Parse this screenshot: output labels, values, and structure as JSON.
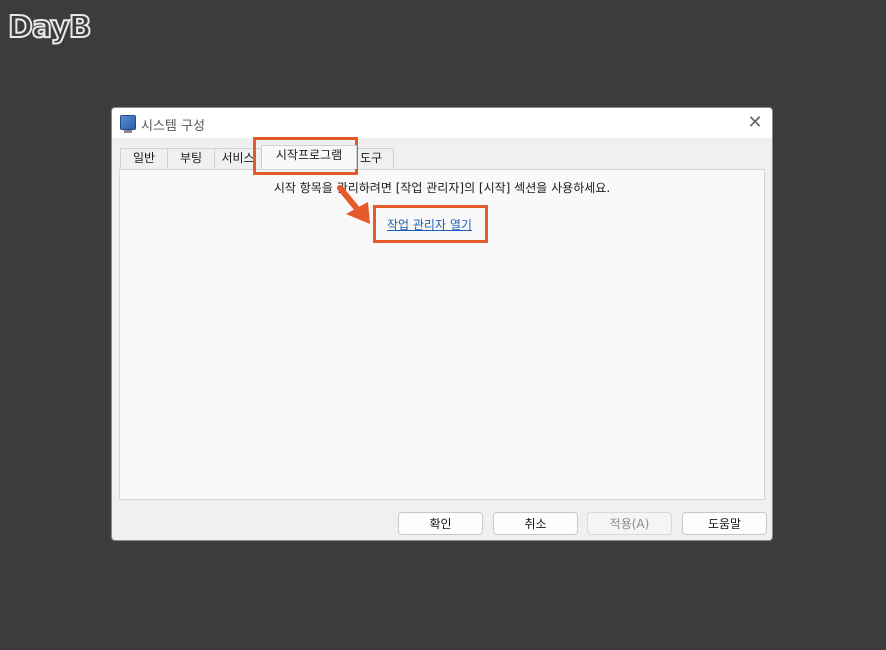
{
  "logo": {
    "text": "DayB"
  },
  "window": {
    "title": "시스템 구성",
    "close_label": "✕"
  },
  "tabs": [
    {
      "label": "일반"
    },
    {
      "label": "부팅"
    },
    {
      "label": "서비스"
    },
    {
      "label": "시작프로그램"
    },
    {
      "label": "도구"
    }
  ],
  "panel": {
    "info_text": "시작 항목을 관리하려면 [작업 관리자]의 [시작] 섹션을 사용하세요.",
    "link_text": "작업 관리자 열기"
  },
  "buttons": {
    "ok": "확인",
    "cancel": "취소",
    "apply": "적용(A)",
    "help": "도움말"
  },
  "colors": {
    "highlight": "#e55a2b",
    "link": "#1a5fb4"
  },
  "icons": {
    "app": "system-config-icon",
    "arrow": "annotation-arrow-icon"
  }
}
